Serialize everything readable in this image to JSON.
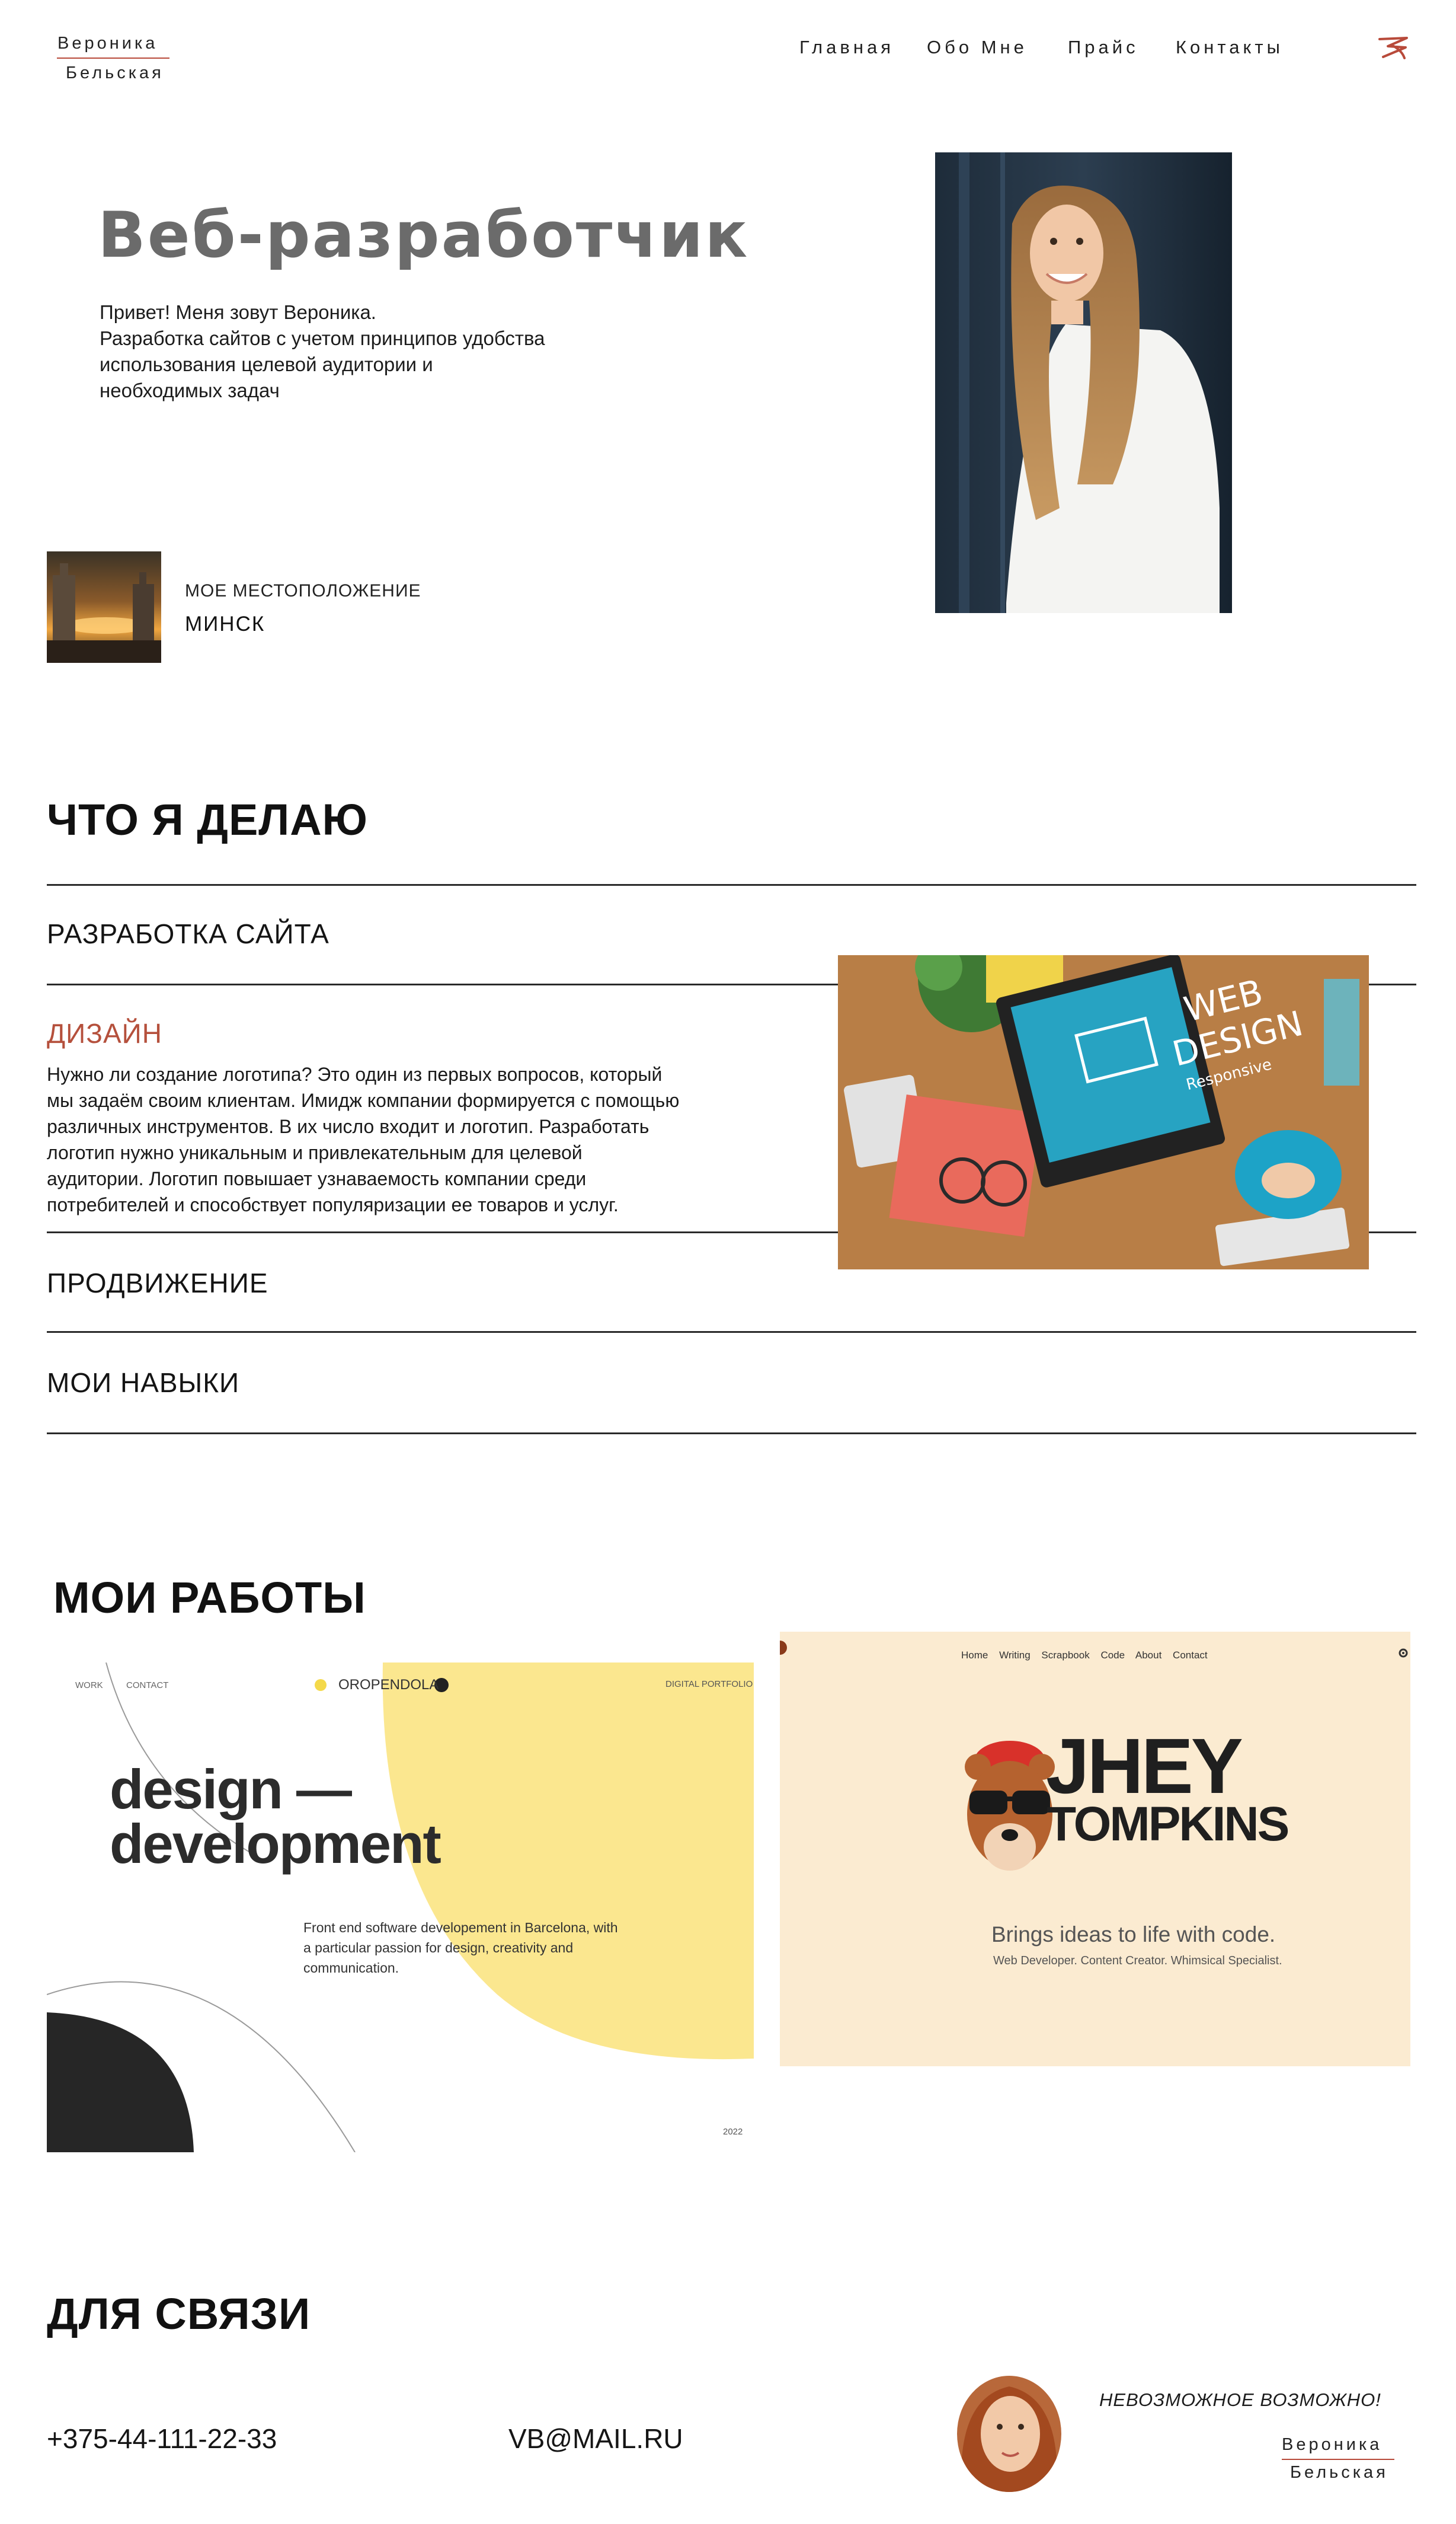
{
  "header": {
    "logo": {
      "first": "Вероника",
      "last": "Бельская"
    },
    "nav": [
      "Главная",
      "Обо Мне",
      "Прайс",
      "Контакты"
    ]
  },
  "hero": {
    "title": "Веб-разработчик",
    "lines": [
      "Привет! Меня зовут Вероника.",
      "Разработка сайтов с учетом принципов удобства",
      "использования целевой аудитории и",
      "необходимых задач"
    ],
    "location_label": "МОЕ МЕСТОПОЛОЖЕНИЕ",
    "location_value": "МИНСК"
  },
  "services": {
    "heading": "ЧТО Я ДЕЛАЮ",
    "items": [
      "РАЗРАБОТКА САЙТА",
      "ДИЗАЙН",
      "ПРОДВИЖЕНИЕ",
      "МОИ НАВЫКИ"
    ],
    "design_text": [
      "Нужно ли создание логотипа? Это один из первых вопросов, который",
      "мы задаём своим клиентам. Имидж компании формируется с помощью",
      "различных инструментов. В их число входит и логотип. Разработать",
      "логотип нужно уникальным и привлекательным для целевой",
      "аудитории. Логотип повышает узнаваемость компании среди",
      "потребителей и способствует популяризации ее товаров и услуг."
    ],
    "image_text": {
      "line1": "WEB",
      "line2": "DESIGN",
      "line3": "Responsive"
    }
  },
  "works": {
    "heading": "МОИ РАБОТЫ",
    "work1": {
      "nav_work": "WORK",
      "nav_contact": "CONTACT",
      "brand": "OROPENDOLA",
      "tag": "DIGITAL PORTFOLIO",
      "title1": "design —",
      "title2": "development",
      "desc1": "Front end software developement in Barcelona, with",
      "desc2": "a particular passion for design, creativity and",
      "desc3": "communication.",
      "year": "2022"
    },
    "work2": {
      "nav": [
        "Home",
        "Writing",
        "Scrapbook",
        "Code",
        "About",
        "Contact"
      ],
      "title1": "JHEY",
      "title2": "TOMPKINS",
      "tagline": "Brings ideas to life with code.",
      "subtag": "Web Developer. Content Creator. Whimsical Specialist."
    }
  },
  "contacts": {
    "heading": "ДЛЯ СВЯЗИ",
    "phone": "+375-44-111-22-33",
    "email": "VB@MAIL.RU",
    "motto": "НЕВОЗМОЖНОЕ ВОЗМОЖНО!"
  },
  "colors": {
    "accent": "#b5503c",
    "work_yellow": "#fbe78f",
    "work_cream": "#fbebd1"
  },
  "icons": {
    "header_right": "signature-logo-icon"
  }
}
